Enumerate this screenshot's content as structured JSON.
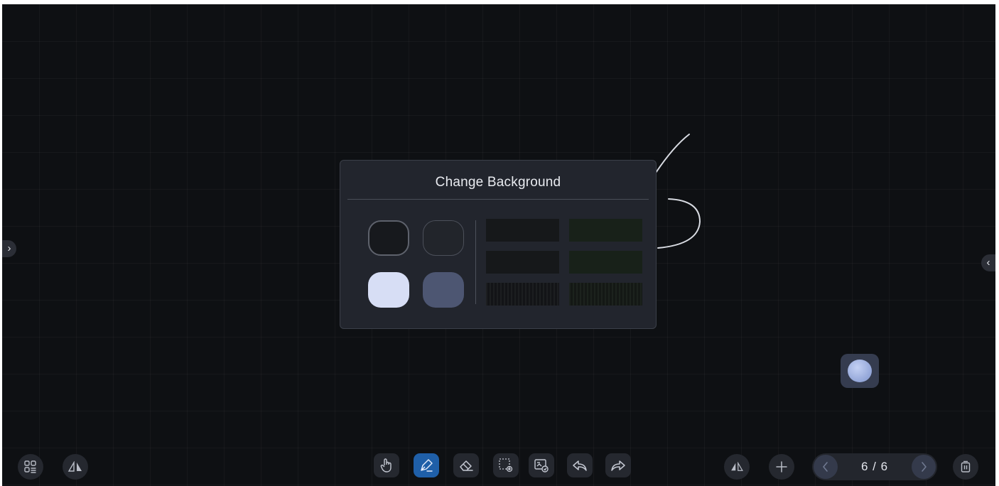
{
  "dialog": {
    "title": "Change Background"
  },
  "edge_tabs": {
    "left_glyph": "›",
    "right_glyph": "‹"
  },
  "swatches": [
    {
      "name": "black",
      "color": "#17191d",
      "selected": true
    },
    {
      "name": "dark-gray",
      "color": "#22252b",
      "selected": false
    },
    {
      "name": "light-blue",
      "color": "#d7def5",
      "selected": false
    },
    {
      "name": "slate-blue",
      "color": "#4d5672",
      "selected": false
    }
  ],
  "textures": [
    {
      "name": "black-board",
      "color": "#16181a"
    },
    {
      "name": "green-board",
      "color": "#182119"
    },
    {
      "name": "black-board-2",
      "color": "#16181a"
    },
    {
      "name": "green-board-2",
      "color": "#182119"
    },
    {
      "name": "black-lined-board",
      "color": "#15171a"
    },
    {
      "name": "green-lined-board",
      "color": "#171c18"
    }
  ],
  "toolbar": {
    "left": [
      "pages-icon",
      "mirror-icon"
    ],
    "center": [
      "hand-pointer-icon",
      "pen-icon",
      "eraser-icon",
      "selection-icon",
      "background-icon",
      "undo-icon",
      "redo-icon"
    ],
    "active_tool": "pen-icon",
    "right": [
      "mirror-toggle-icon",
      "add-page-icon",
      "delete-icon"
    ]
  },
  "pager": {
    "count": "6 / 6"
  },
  "colors": {
    "canvas": "#0e1013",
    "dialog": "#22252d",
    "accent": "#1f5fa8",
    "ink": "#d9dce3"
  }
}
